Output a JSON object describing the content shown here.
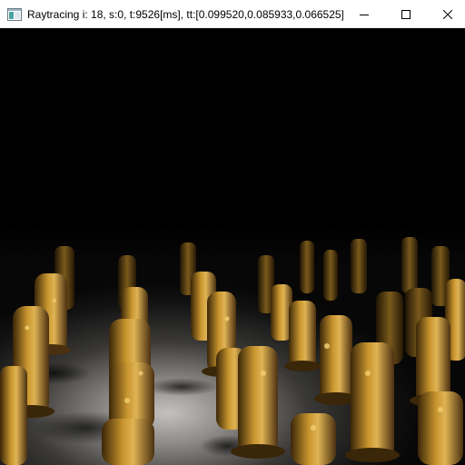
{
  "window": {
    "title": "Raytracing i: 18, s:0, t:9526[ms], tt:[0.099520,0.085933,0.066525][...",
    "icons": {
      "app": "app-window-icon",
      "minimize": "minimize-icon",
      "maximize": "maximize-icon",
      "close": "close-icon"
    }
  },
  "scene": {
    "description_icon": "raytraced-render",
    "colors": {
      "background": "#000000",
      "floor_lit": "#b8b6b2",
      "floor_dark": "#0b0b0b",
      "figure_gold": "#c8952e",
      "figure_dark": "#3a2608"
    }
  }
}
